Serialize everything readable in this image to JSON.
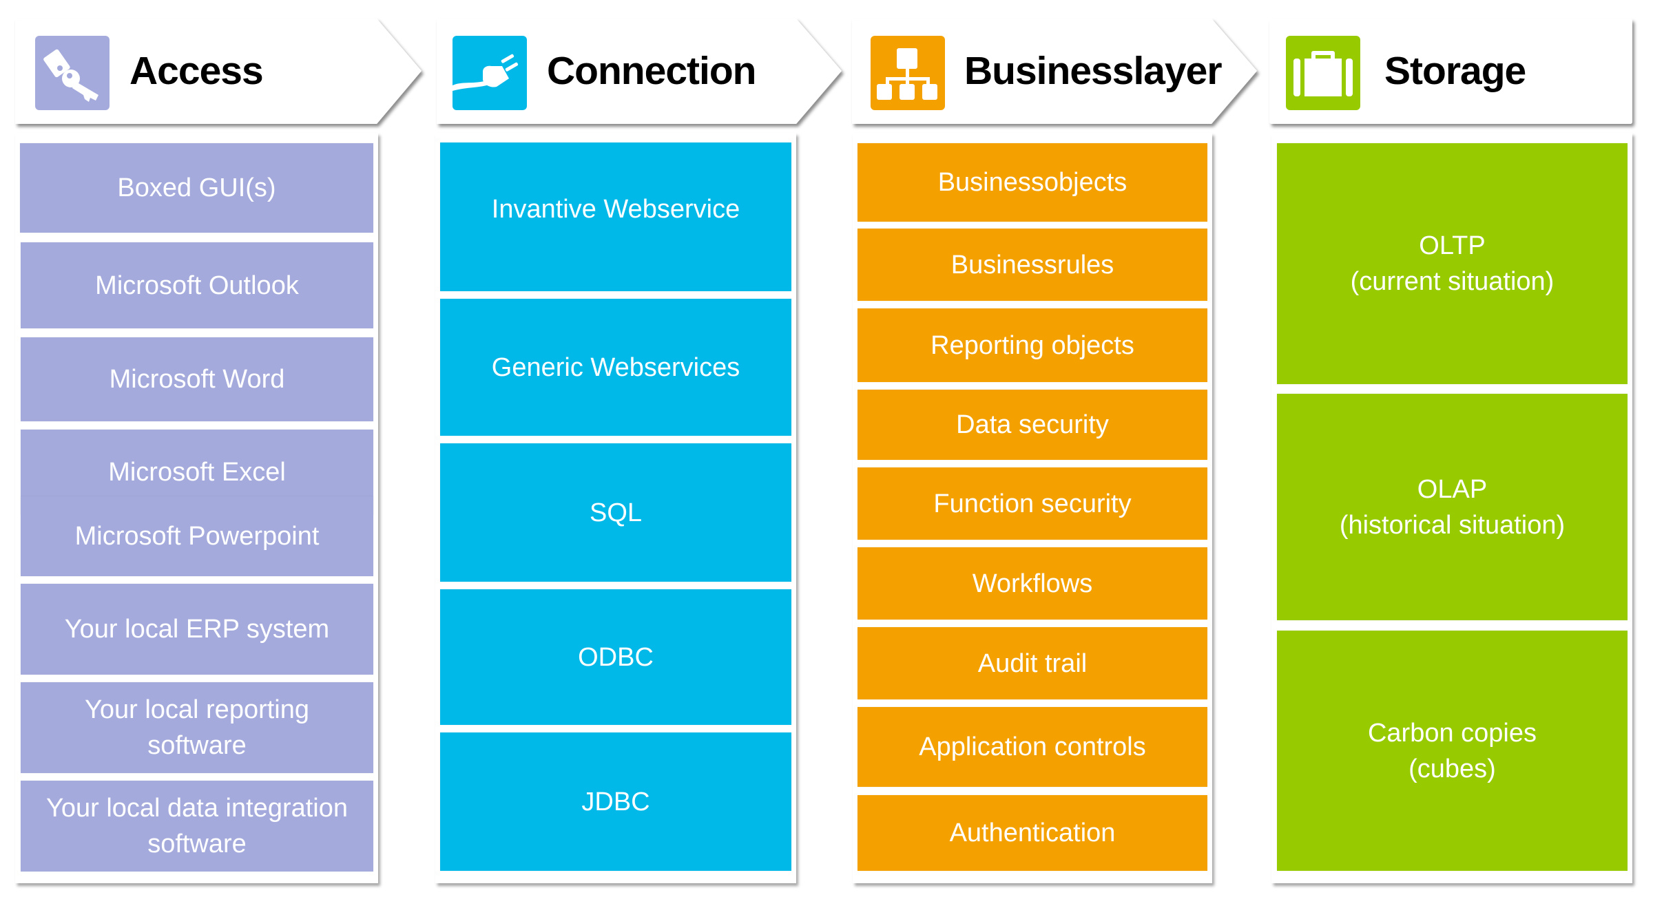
{
  "colors": {
    "access": "#a4aadb",
    "connection": "#00b9e8",
    "businesslayer": "#f4a100",
    "storage": "#97cb00"
  },
  "columns": [
    {
      "id": "access",
      "title": "Access",
      "icon": "key-icon",
      "items": [
        "Boxed GUI(s)",
        "Microsoft Outlook",
        "Microsoft Word",
        "Microsoft Excel",
        "Microsoft Powerpoint",
        "Your local ERP system",
        "Your local reporting\nsoftware",
        "Your local data integration\nsoftware"
      ]
    },
    {
      "id": "connection",
      "title": "Connection",
      "icon": "plug-icon",
      "items": [
        "Invantive Webservice",
        "Generic Webservices",
        "SQL",
        "ODBC",
        "JDBC"
      ]
    },
    {
      "id": "businesslayer",
      "title": "Businesslayer",
      "icon": "hierarchy-icon",
      "items": [
        "Businessobjects",
        "Businessrules",
        "Reporting objects",
        "Data security",
        "Function security",
        "Workflows",
        "Audit trail",
        "Application controls",
        "Authentication"
      ]
    },
    {
      "id": "storage",
      "title": "Storage",
      "icon": "briefcase-icon",
      "items": [
        "OLTP\n(current situation)",
        "OLAP\n(historical situation)",
        "Carbon copies\n(cubes)"
      ]
    }
  ]
}
